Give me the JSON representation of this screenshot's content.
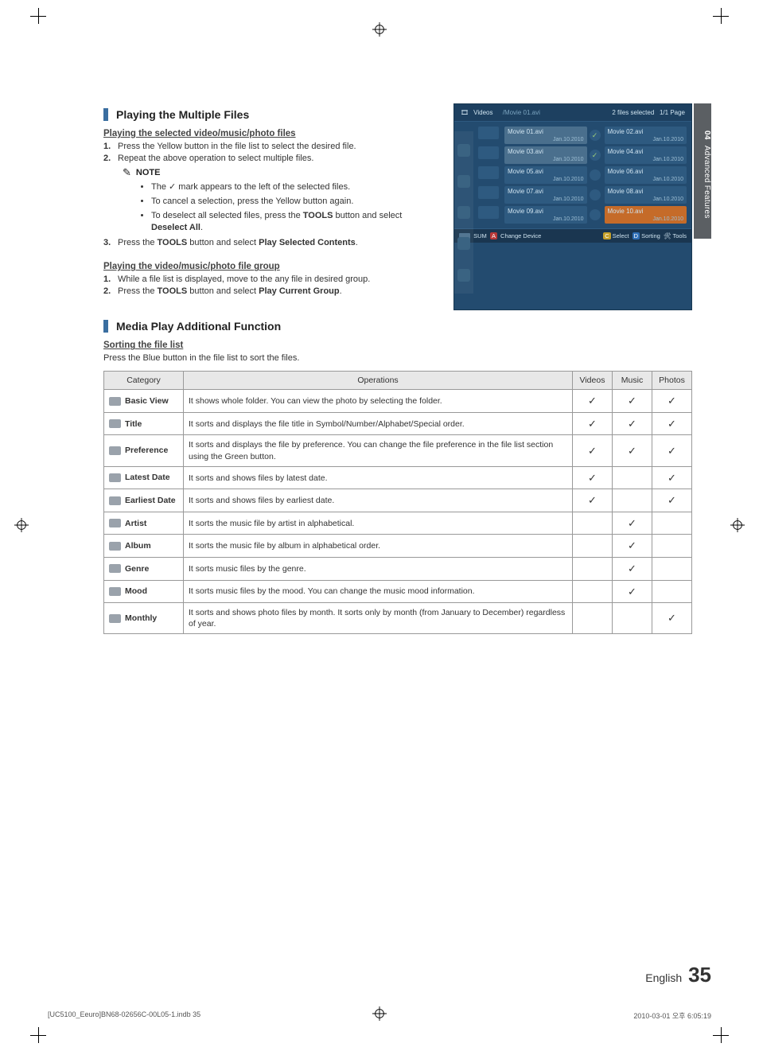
{
  "sideTab": {
    "num": "04",
    "label": "Advanced Features"
  },
  "sec1": {
    "title": "Playing the Multiple Files",
    "sub1": "Playing the selected video/music/photo files",
    "steps1": [
      "Press the Yellow button in the file list to select the desired file.",
      "Repeat the above operation to select multiple files."
    ],
    "noteLabel": "NOTE",
    "bullets": [
      "The ✓ mark appears to the left of the selected files.",
      "To cancel a selection, press the Yellow button again.",
      "To deselect all selected files, press the TOOLS button and select Deselect All."
    ],
    "steps2": [
      "Press the TOOLS button and select Play Selected Contents."
    ],
    "sub2": "Playing the video/music/photo file group",
    "steps3": [
      "While a file list is displayed, move to the any file in desired group.",
      "Press the TOOLS button and select Play Current Group."
    ]
  },
  "screenshot": {
    "breadcrumb": "Videos",
    "path": "/Movie 01.avi",
    "statusSel": "2 files selected",
    "statusPage": "1/1 Page",
    "files": [
      {
        "name": "Movie 01.avi",
        "date": "Jan.10.2010",
        "sel": true
      },
      {
        "name": "Movie 02.avi",
        "date": "Jan.10.2010",
        "sel": false
      },
      {
        "name": "Movie 03.avi",
        "date": "Jan.10.2010",
        "sel": true
      },
      {
        "name": "Movie 04.avi",
        "date": "Jan.10.2010",
        "sel": false
      },
      {
        "name": "Movie 05.avi",
        "date": "Jan.10.2010",
        "sel": false
      },
      {
        "name": "Movie 06.avi",
        "date": "Jan.10.2010",
        "sel": false
      },
      {
        "name": "Movie 07.avi",
        "date": "Jan.10.2010",
        "sel": false
      },
      {
        "name": "Movie 08.avi",
        "date": "Jan.10.2010",
        "sel": false
      },
      {
        "name": "Movie 09.avi",
        "date": "Jan.10.2010",
        "sel": false
      },
      {
        "name": "Movie 10.avi",
        "date": "Jan.10.2010",
        "sel": false,
        "hi": true
      }
    ],
    "sum": "SUM",
    "changeDev": "Change Device",
    "select": "Select",
    "sorting": "Sorting",
    "tools": "Tools"
  },
  "sec2": {
    "title": "Media Play Additional Function",
    "sub": "Sorting the file list",
    "intro": "Press the Blue button in the file list to sort the files.",
    "headers": {
      "cat": "Category",
      "ops": "Operations",
      "v": "Videos",
      "m": "Music",
      "p": "Photos"
    },
    "rows": [
      {
        "cat": "Basic View",
        "ops": "It shows whole folder. You can view the photo by selecting the folder.",
        "v": true,
        "m": true,
        "p": true
      },
      {
        "cat": "Title",
        "ops": "It sorts and displays the file title in Symbol/Number/Alphabet/Special order.",
        "v": true,
        "m": true,
        "p": true
      },
      {
        "cat": "Preference",
        "ops": "It sorts and displays the file by preference. You can change the file preference in the file list section using the Green button.",
        "v": true,
        "m": true,
        "p": true
      },
      {
        "cat": "Latest Date",
        "ops": "It sorts and shows files by latest date.",
        "v": true,
        "m": false,
        "p": true
      },
      {
        "cat": "Earliest Date",
        "ops": "It sorts and shows files by earliest date.",
        "v": true,
        "m": false,
        "p": true
      },
      {
        "cat": "Artist",
        "ops": "It sorts the music file by artist in alphabetical.",
        "v": false,
        "m": true,
        "p": false
      },
      {
        "cat": "Album",
        "ops": "It sorts the music file by album in alphabetical order.",
        "v": false,
        "m": true,
        "p": false
      },
      {
        "cat": "Genre",
        "ops": "It sorts music files by the genre.",
        "v": false,
        "m": true,
        "p": false
      },
      {
        "cat": "Mood",
        "ops": "It sorts music files by the mood. You can change the music mood information.",
        "v": false,
        "m": true,
        "p": false
      },
      {
        "cat": "Monthly",
        "ops": "It sorts and shows photo files by month. It sorts only by month (from January to December) regardless of year.",
        "v": false,
        "m": false,
        "p": true
      }
    ]
  },
  "footer": {
    "lang": "English",
    "page": "35"
  },
  "printInfo": {
    "left": "[UC5100_Eeuro]BN68-02656C-00L05-1.indb   35",
    "right": "2010-03-01   오후 6:05:19"
  }
}
